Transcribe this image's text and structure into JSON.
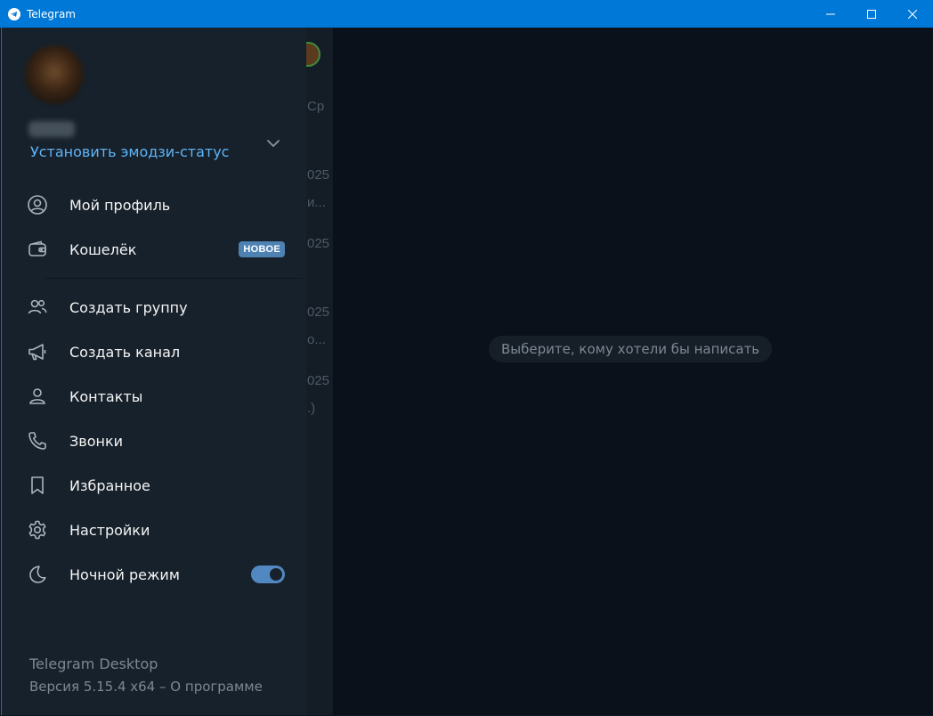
{
  "window": {
    "title": "Telegram"
  },
  "chatlist_peek": {
    "lines": [
      "Ср",
      "025",
      "и...",
      "025",
      "025",
      "о...",
      "025",
      ".)"
    ]
  },
  "drawer": {
    "emoji_status_label": "Установить эмодзи-статус",
    "menu": [
      {
        "id": "profile",
        "label": "Мой профиль",
        "icon": "user-circle-icon"
      },
      {
        "id": "wallet",
        "label": "Кошелёк",
        "icon": "wallet-icon",
        "badge": "НОВОЕ"
      },
      {
        "id": "new-group",
        "label": "Создать группу",
        "icon": "group-icon"
      },
      {
        "id": "new-channel",
        "label": "Создать канал",
        "icon": "megaphone-icon"
      },
      {
        "id": "contacts",
        "label": "Контакты",
        "icon": "contact-icon"
      },
      {
        "id": "calls",
        "label": "Звонки",
        "icon": "phone-icon"
      },
      {
        "id": "saved",
        "label": "Избранное",
        "icon": "bookmark-icon"
      },
      {
        "id": "settings",
        "label": "Настройки",
        "icon": "gear-icon"
      },
      {
        "id": "night-mode",
        "label": "Ночной режим",
        "icon": "moon-icon",
        "toggle_on": true
      }
    ],
    "footer": {
      "app_name": "Telegram Desktop",
      "version_line": "Версия 5.15.4 x64 – О программе"
    }
  },
  "main": {
    "empty_hint": "Выберите, кому хотели бы написать"
  },
  "colors": {
    "titlebar": "#0078d7",
    "drawer_bg": "#17212b",
    "accent": "#5eb5f7",
    "badge": "#4d82b3",
    "toggle": "#5288c1"
  }
}
